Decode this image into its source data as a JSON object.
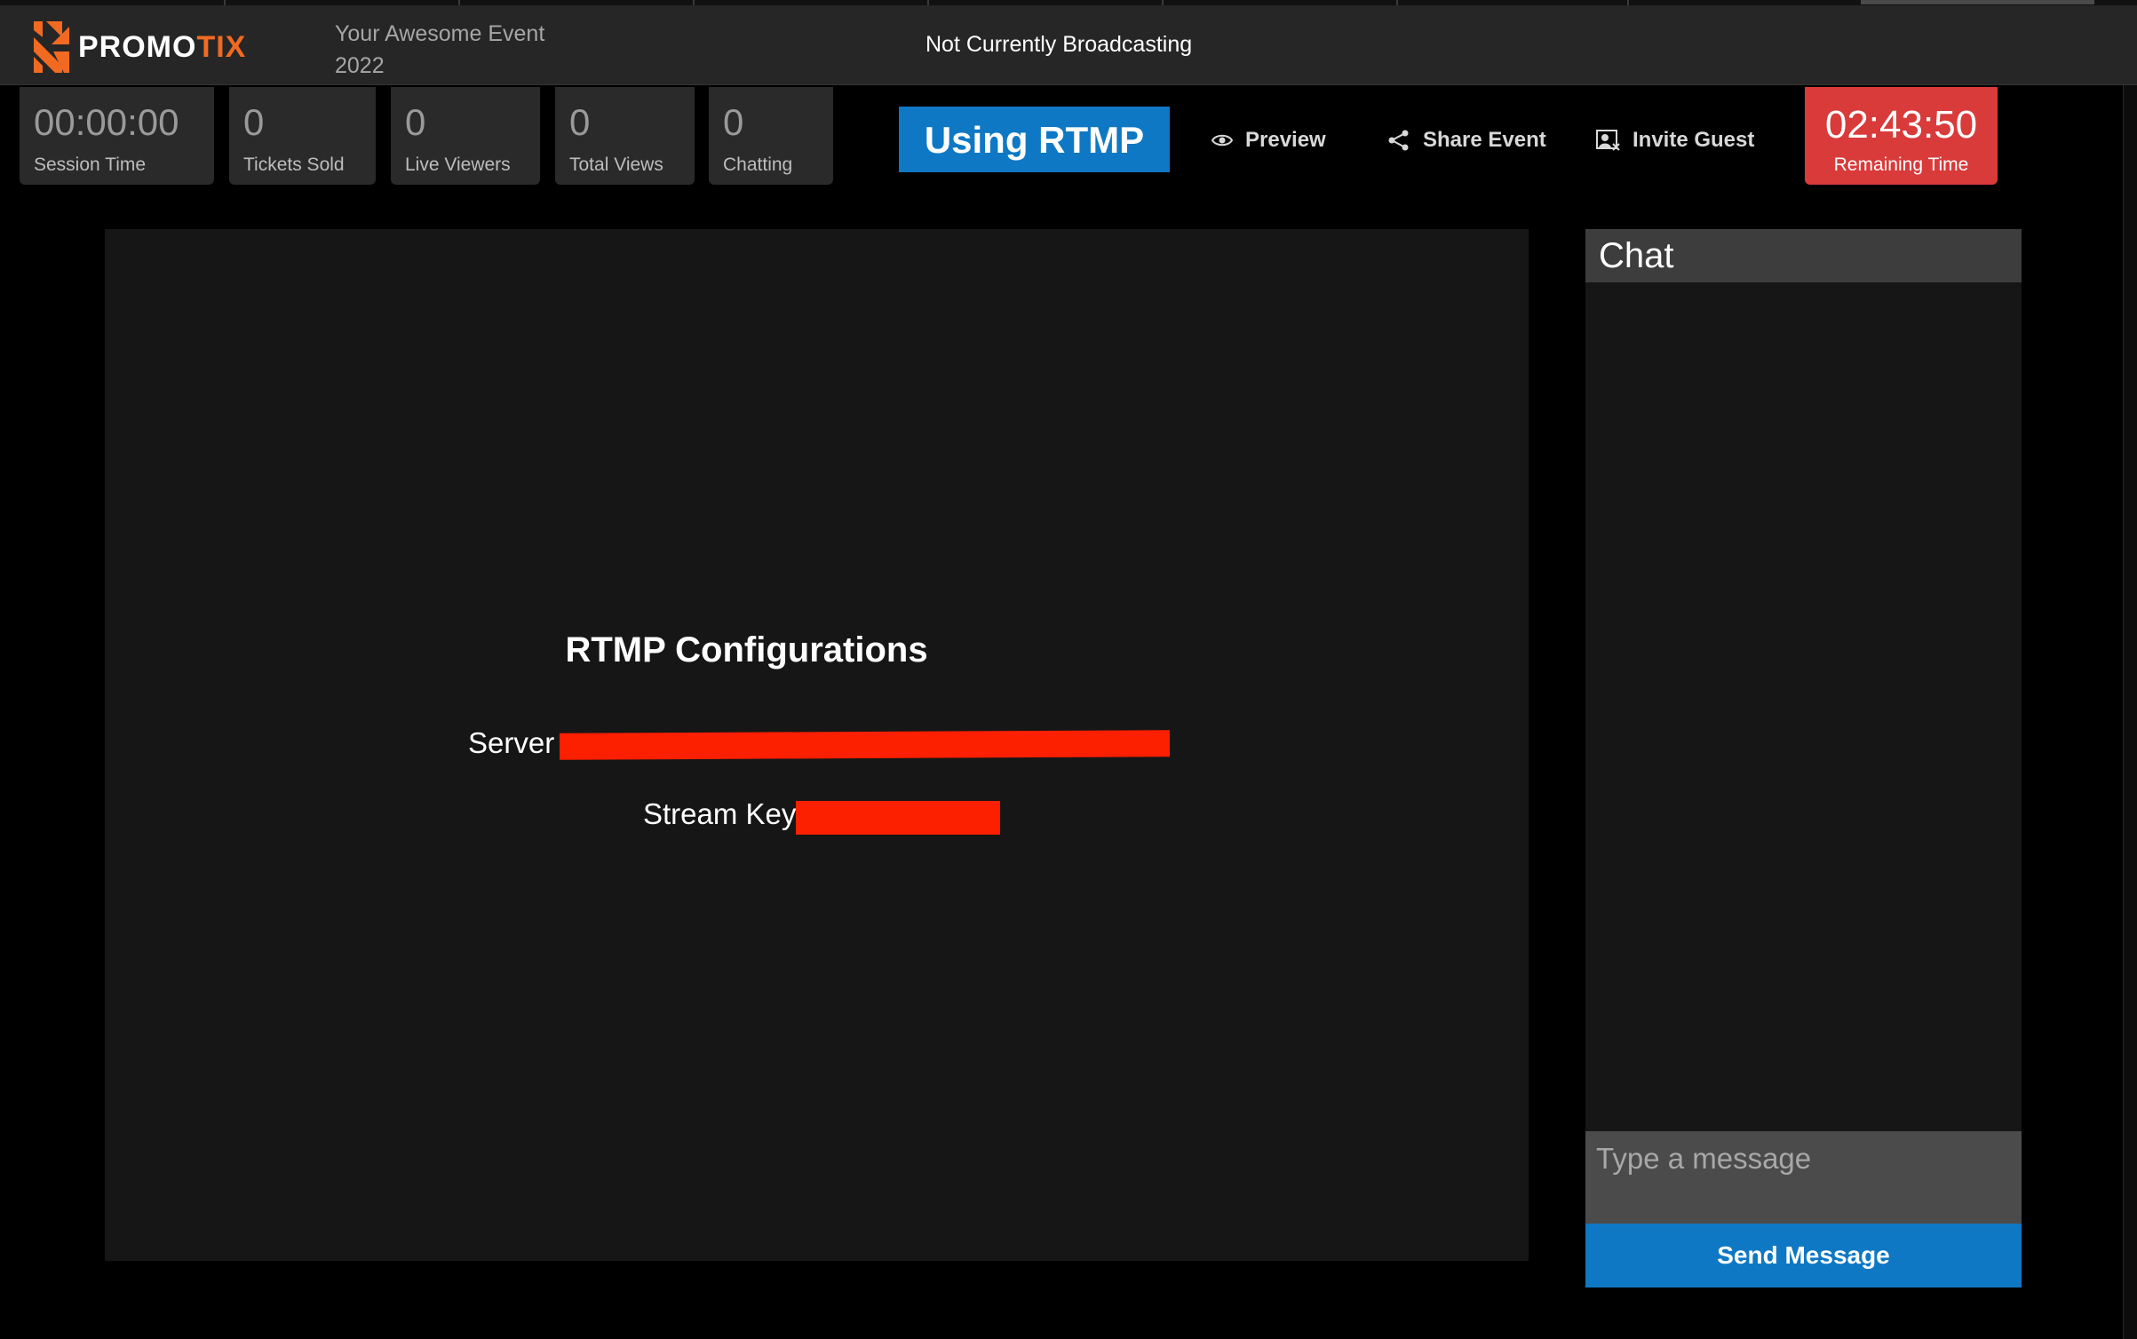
{
  "brand": {
    "name_white": "PROMO",
    "name_orange": "TIX",
    "accent": "#f26a21"
  },
  "event": {
    "title": "Your Awesome Event 2022"
  },
  "broadcast": {
    "status": "Not Currently Broadcasting"
  },
  "stats": [
    {
      "value": "00:00:00",
      "label": "Session Time"
    },
    {
      "value": "0",
      "label": "Tickets Sold"
    },
    {
      "value": "0",
      "label": "Live Viewers"
    },
    {
      "value": "0",
      "label": "Total Views"
    },
    {
      "value": "0",
      "label": "Chatting"
    }
  ],
  "toolbar": {
    "mode_label": "Using RTMP",
    "preview_label": "Preview",
    "share_label": "Share Event",
    "invite_label": "Invite Guest",
    "preview_icon": "eye-icon",
    "share_icon": "share-icon",
    "invite_icon": "invite-icon"
  },
  "remaining": {
    "value": "02:43:50",
    "label": "Remaining Time",
    "color": "#d93a3a"
  },
  "rtmp": {
    "title": "RTMP Configurations",
    "server_label": "Server",
    "stream_key_label": "Stream Key"
  },
  "chat": {
    "title": "Chat",
    "placeholder": "Type a message",
    "send_label": "Send Message",
    "button_color": "#0f78c4"
  }
}
